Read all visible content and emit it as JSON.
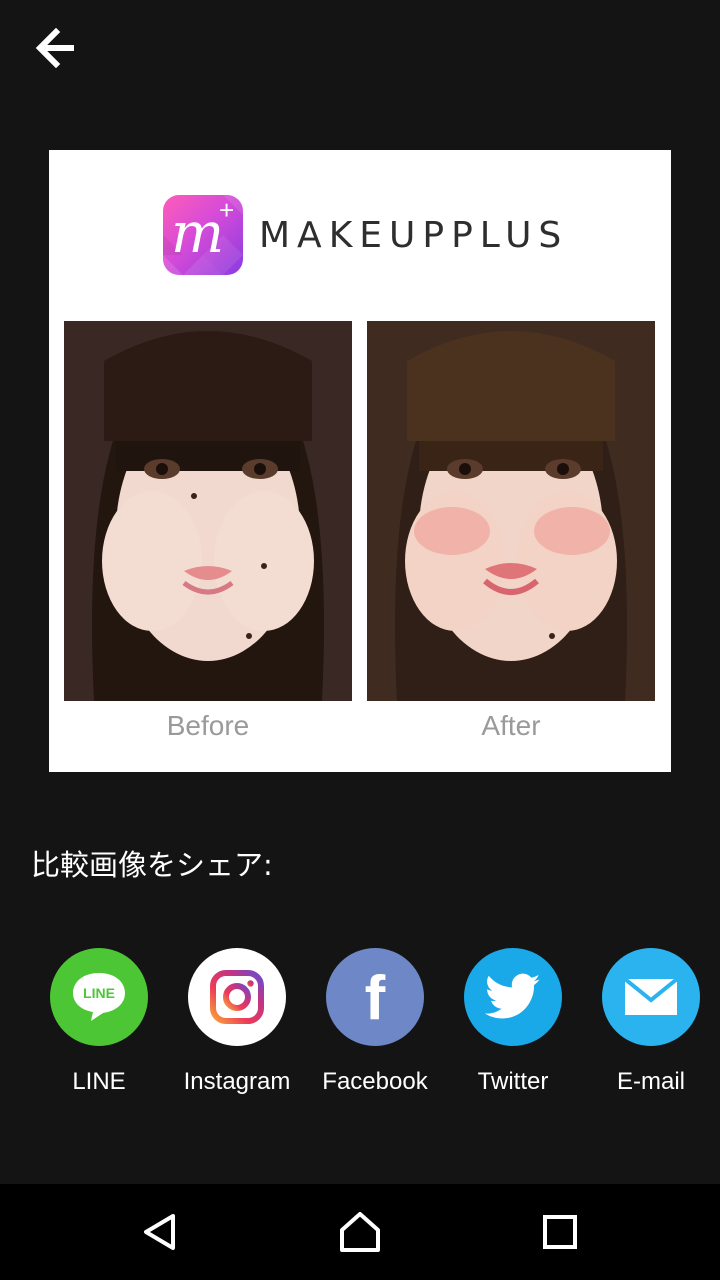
{
  "header": {
    "back_icon": "arrow-left-icon"
  },
  "preview": {
    "brand_name": "MAKEUPPLUS",
    "brand_logo_letter": "m",
    "brand_logo_plus": "+",
    "before_label": "Before",
    "after_label": "After"
  },
  "share": {
    "title": "比較画像をシェア:",
    "items": [
      {
        "label": "LINE",
        "icon": "line-icon",
        "icon_text": "LINE",
        "color": "#4cc635"
      },
      {
        "label": "Instagram",
        "icon": "instagram-icon",
        "color": "#ffffff"
      },
      {
        "label": "Facebook",
        "icon": "facebook-icon",
        "icon_text": "f",
        "color": "#6d87c7"
      },
      {
        "label": "Twitter",
        "icon": "twitter-icon",
        "color": "#1aa9e8"
      },
      {
        "label": "E-mail",
        "icon": "email-icon",
        "color": "#2bb3f0"
      }
    ]
  },
  "navbar": {
    "back": "triangle-back-icon",
    "home": "home-icon",
    "recents": "square-recents-icon"
  }
}
